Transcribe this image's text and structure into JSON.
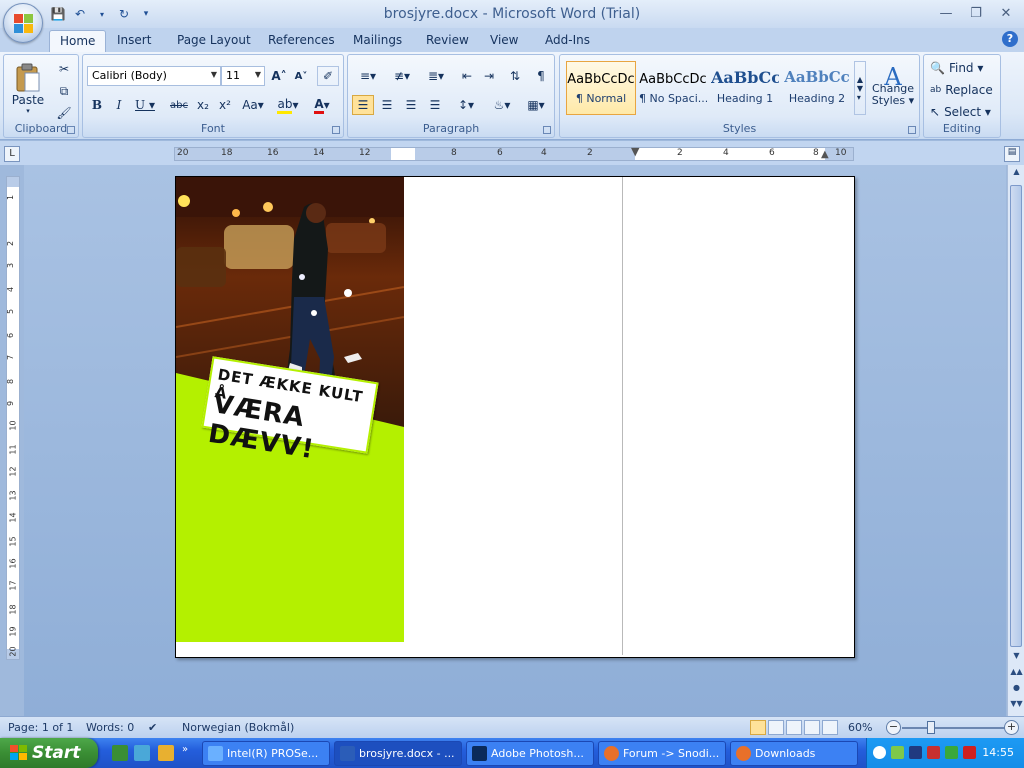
{
  "window": {
    "title": "brosjyre.docx - Microsoft Word (Trial)"
  },
  "qat": {
    "save_icon": "save-icon",
    "undo_icon": "undo-icon",
    "redo_icon": "redo-icon",
    "customize_icon": "customize-qat-icon"
  },
  "tabs": [
    "Home",
    "Insert",
    "Page Layout",
    "References",
    "Mailings",
    "Review",
    "View",
    "Add-Ins"
  ],
  "ribbon": {
    "clipboard": {
      "label": "Clipboard",
      "paste": "Paste"
    },
    "font": {
      "label": "Font",
      "name": "Calibri (Body)",
      "size": "11"
    },
    "paragraph": {
      "label": "Paragraph"
    },
    "styles": {
      "label": "Styles",
      "items": [
        {
          "sample": "AaBbCcDc",
          "name": "¶ Normal"
        },
        {
          "sample": "AaBbCcDc",
          "name": "¶ No Spaci..."
        },
        {
          "sample": "AaBbCc",
          "name": "Heading 1"
        },
        {
          "sample": "AaBbCc",
          "name": "Heading 2"
        }
      ],
      "change_styles_1": "Change",
      "change_styles_2": "Styles"
    },
    "editing": {
      "label": "Editing",
      "find": "Find",
      "replace": "Replace",
      "select": "Select"
    }
  },
  "ruler": {
    "numbers": [
      "20",
      "18",
      "16",
      "14",
      "12",
      "8",
      "6",
      "4",
      "2",
      "2",
      "4",
      "6",
      "8",
      "10"
    ],
    "vnumbers": [
      "1",
      "2",
      "3",
      "4",
      "5",
      "6",
      "7",
      "8",
      "9",
      "10",
      "11",
      "12",
      "13",
      "14",
      "15",
      "16",
      "17",
      "18",
      "19",
      "20"
    ]
  },
  "document": {
    "sticker_line1": "DET ÆKKE KULT Å",
    "sticker_line2": "VÆRA DÆVV!"
  },
  "statusbar": {
    "page": "Page: 1 of 1",
    "words": "Words: 0",
    "language": "Norwegian (Bokmål)",
    "zoom": "60%"
  },
  "taskbar": {
    "start": "Start",
    "tasks": [
      {
        "label": "Intel(R) PROSe...",
        "icon": "network-icon"
      },
      {
        "label": "brosjyre.docx - ...",
        "icon": "word-icon"
      },
      {
        "label": "Adobe Photosh...",
        "icon": "photoshop-icon"
      },
      {
        "label": "Forum -> Snodi...",
        "icon": "firefox-icon"
      },
      {
        "label": "Downloads",
        "icon": "firefox-icon"
      }
    ],
    "clock": "14:55"
  },
  "colors": {
    "brochure_green": "#b4f000",
    "ribbon_blue": "#dce8f7",
    "taskbar_blue": "#245edc",
    "start_green": "#3a8e34"
  }
}
